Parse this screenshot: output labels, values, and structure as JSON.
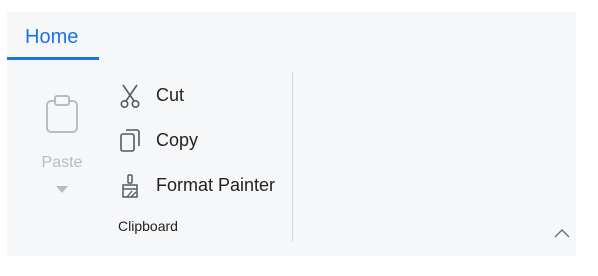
{
  "tabs": {
    "home_label": "Home"
  },
  "clipboard": {
    "paste_label": "Paste",
    "cut_label": "Cut",
    "copy_label": "Copy",
    "format_painter_label": "Format Painter",
    "group_label": "Clipboard"
  },
  "icons": {
    "paste": "clipboard-icon",
    "paste_dropdown": "caret-down-icon",
    "cut": "scissors-icon",
    "copy": "copy-icon",
    "format_painter": "paintbrush-icon",
    "collapse": "chevron-up-icon"
  },
  "colors": {
    "accent": "#1a73e8",
    "ribbon_background": "#f6f7f9",
    "disabled": "#b8bcc2",
    "text": "#222222"
  },
  "state": {
    "paste_enabled": false
  }
}
